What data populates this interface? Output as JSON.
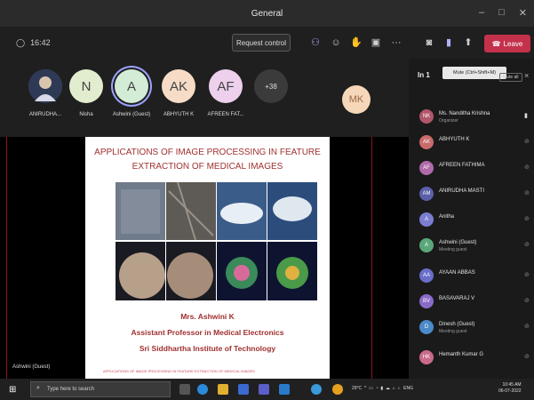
{
  "window": {
    "title": "General",
    "controls": [
      "–",
      "□",
      "✕"
    ]
  },
  "toolbar": {
    "timer": "16:42",
    "request_control_label": "Request control",
    "leave_label": "Leave",
    "icons": [
      "participants-icon",
      "chat-icon",
      "reactions-icon",
      "rooms-icon",
      "more-icon",
      "camera-icon",
      "mic-icon",
      "share-icon"
    ]
  },
  "avatars": [
    {
      "initials": "",
      "name": "ANIRUDHA...",
      "color": "#4a5a78"
    },
    {
      "initials": "N",
      "name": "Nisha",
      "color": "#e2eccf"
    },
    {
      "initials": "A",
      "name": "Ashwini (Guest)",
      "color": "#d3ecd6"
    },
    {
      "initials": "AK",
      "name": "ABHYUTH K",
      "color": "#f6dcc6"
    },
    {
      "initials": "AF",
      "name": "AFREEN FAT...",
      "color": "#edd0ec"
    },
    {
      "initials": "+38",
      "name": "",
      "color": "#3b3b3b"
    }
  ],
  "active_speaker": {
    "initials": "MK"
  },
  "slide": {
    "title_line1": "APPLICATIONS OF IMAGE PROCESSING IN FEATURE",
    "title_line2": "EXTRACTION OF MEDICAL IMAGES",
    "presenter": "Mrs. Ashwini K",
    "role": "Assistant Professor in Medical Electronics",
    "institute": "Sri Siddhartha Institute of Technology",
    "footer": "APPLICATIONS OF IMAGE PROCESSING IN FEATURE EXTRACTION OF MEDICAL IMAGES"
  },
  "stage_caption": "Ashwini (Guest)",
  "panel": {
    "header": "In 1",
    "tooltip": "Mute (Ctrl+Shift+M)",
    "mute_all_label": "Mute all",
    "participants": [
      {
        "name": "Ms. Nanditha Krishna",
        "role": "Organizer",
        "initials": "NK",
        "color": "#b0566a"
      },
      {
        "name": "ABHYUTH K",
        "role": "",
        "initials": "AK",
        "color": "#c96a6a"
      },
      {
        "name": "AFREEN FATHIMA",
        "role": "",
        "initials": "AF",
        "color": "#b06aa8"
      },
      {
        "name": "ANIRUDHA MASTI",
        "role": "",
        "initials": "AM",
        "color": "#5a5fa8"
      },
      {
        "name": "Anitha",
        "role": "",
        "initials": "A",
        "color": "#7b7ed0"
      },
      {
        "name": "Ashwini (Guest)",
        "role": "Meeting guest",
        "initials": "A",
        "color": "#5aa87a"
      },
      {
        "name": "AYAAN ABBAS",
        "role": "",
        "initials": "AA",
        "color": "#6a6ec9"
      },
      {
        "name": "BASAVARAJ V",
        "role": "",
        "initials": "BV",
        "color": "#8a6ac9"
      },
      {
        "name": "Dinesh (Guest)",
        "role": "Meeting guest",
        "initials": "D",
        "color": "#4a8ac9"
      },
      {
        "name": "Hemanth Kumar G",
        "role": "",
        "initials": "HK",
        "color": "#c96a8a"
      }
    ]
  },
  "taskbar": {
    "search_placeholder": "Type here to search",
    "weather": "29°C",
    "language": "ENG",
    "time": "10:45 AM",
    "date": "06-07-2022"
  }
}
